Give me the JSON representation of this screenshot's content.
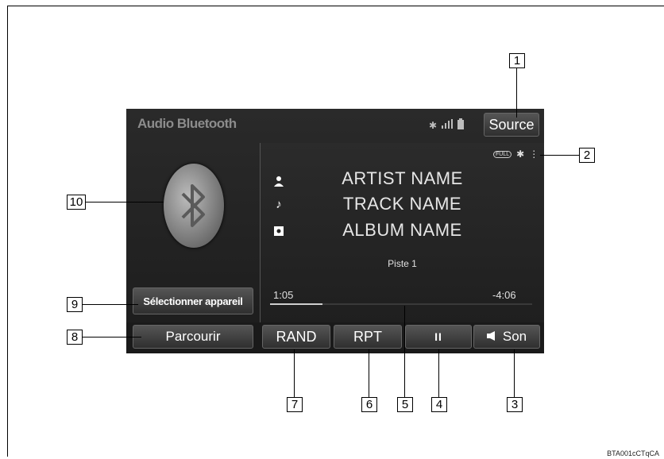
{
  "screen": {
    "title": "Audio Bluetooth",
    "source_label": "Source",
    "status_icons": [
      "bluetooth-icon",
      "signal-icon",
      "battery-icon"
    ],
    "mini_icons": [
      "full-icon",
      "bluetooth-icon",
      "menu-dots-icon"
    ],
    "mini_full_label": "FULL"
  },
  "track": {
    "artist": "ARTIST NAME",
    "title": "TRACK NAME",
    "album": "ALBUM NAME",
    "track_label": "Piste 1",
    "elapsed": "1:05",
    "remaining": "-4:06",
    "progress_fraction": 0.2
  },
  "left_panel": {
    "select_device_label": "Sélectionner appareil"
  },
  "controls": {
    "browse_label": "Parcourir",
    "random_label": "RAND",
    "repeat_label": "RPT",
    "pause_label": "II",
    "sound_label": "Son"
  },
  "callouts": {
    "c1": "1",
    "c2": "2",
    "c3": "3",
    "c4": "4",
    "c5": "5",
    "c6": "6",
    "c7": "7",
    "c8": "8",
    "c9": "9",
    "c10": "10"
  },
  "credit": "BTA001cCTqCA"
}
